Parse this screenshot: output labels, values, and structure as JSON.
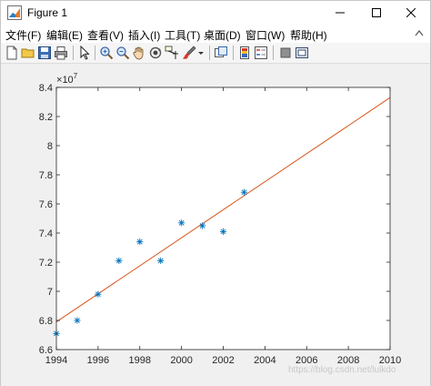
{
  "window": {
    "title": "Figure 1"
  },
  "menu": {
    "items": [
      "文件(F)",
      "编辑(E)",
      "查看(V)",
      "插入(I)",
      "工具(T)",
      "桌面(D)",
      "窗口(W)",
      "帮助(H)"
    ]
  },
  "toolbar": {
    "icons": [
      "new-file-icon",
      "open-folder-icon",
      "save-icon",
      "print-icon",
      "pointer-icon",
      "zoom-in-icon",
      "zoom-out-icon",
      "pan-hand-icon",
      "rotate-3d-icon",
      "data-cursor-icon",
      "brush-icon",
      "dropdown-arrow-icon",
      "link-plot-icon",
      "colorbar-icon",
      "legend-icon",
      "hide-plot-tools-icon",
      "show-plot-tools-icon"
    ]
  },
  "colors": {
    "marker": "#0072bd",
    "fit_line": "#d95319",
    "axes_bg": "#ffffff",
    "figure_bg": "#f0f0f0"
  },
  "watermark": "https://blog.csdn.net/lulkdo",
  "chart_data": {
    "type": "scatter",
    "title": "",
    "xlabel": "",
    "ylabel": "",
    "xlim": [
      1994,
      2010
    ],
    "ylim": [
      6.6,
      8.4
    ],
    "y_multiplier": "10",
    "y_exponent": "7",
    "xticks": [
      1994,
      1996,
      1998,
      2000,
      2002,
      2004,
      2006,
      2008,
      2010
    ],
    "yticks": [
      6.6,
      6.8,
      7,
      7.2,
      7.4,
      7.6,
      7.8,
      8,
      8.2,
      8.4
    ],
    "grid": false,
    "series": [
      {
        "type": "scatter",
        "marker": "*",
        "x": [
          1994,
          1995,
          1996,
          1997,
          1998,
          1999,
          2000,
          2001,
          2002,
          2003
        ],
        "y": [
          6.71,
          6.8,
          6.98,
          7.21,
          7.34,
          7.21,
          7.47,
          7.45,
          7.41,
          7.68
        ]
      },
      {
        "type": "line",
        "x": [
          1994,
          2010
        ],
        "y": [
          6.79,
          8.33
        ]
      }
    ]
  }
}
